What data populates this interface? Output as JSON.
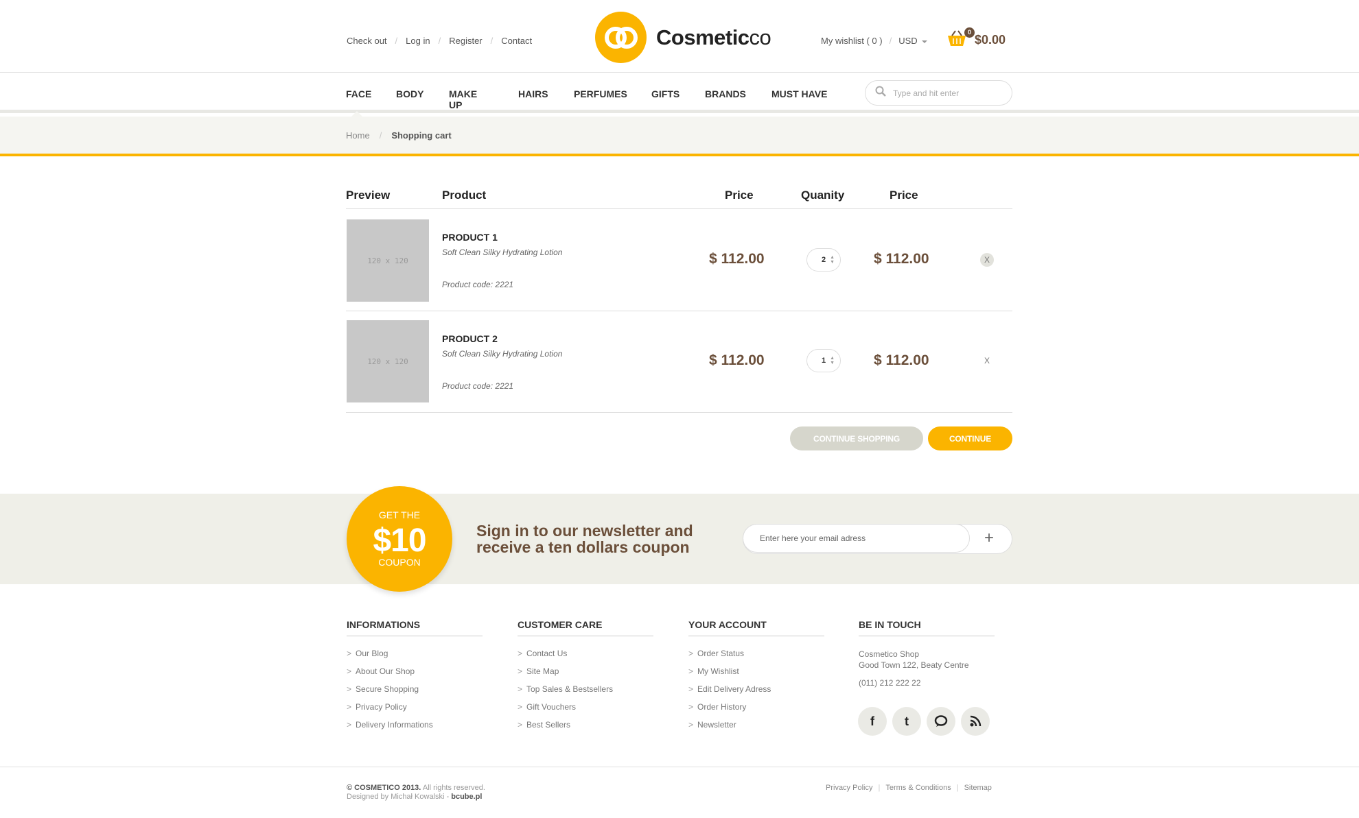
{
  "header": {
    "top_links": [
      "Check out",
      "Log in",
      "Register",
      "Contact"
    ],
    "brand_bold": "Cosmetic",
    "brand_light": "co",
    "wishlist": "My wishlist ( 0 )",
    "currency": "USD",
    "cart_count": "0",
    "cart_total": "$0.00"
  },
  "nav": {
    "items": [
      "FACE",
      "BODY",
      "MAKE UP",
      "HAIRS",
      "PERFUMES",
      "GIFTS",
      "BRANDS",
      "MUST HAVE"
    ],
    "search_placeholder": "Type and hit enter"
  },
  "breadcrumb": {
    "home": "Home",
    "current": "Shopping cart"
  },
  "cart": {
    "headers": {
      "preview": "Preview",
      "product": "Product",
      "price": "Price",
      "quantity": "Quanity",
      "total": "Price"
    },
    "items": [
      {
        "thumb": "120 x 120",
        "name": "PRODUCT 1",
        "desc": "Soft Clean Silky Hydrating Lotion",
        "code_label": "Product code:",
        "code": "2221",
        "price": "$ 112.00",
        "qty": "2",
        "total": "$ 112.00",
        "remove": "X"
      },
      {
        "thumb": "120 x 120",
        "name": "PRODUCT 2",
        "desc": "Soft Clean Silky Hydrating Lotion",
        "code_label": "Product code:",
        "code": "2221",
        "price": "$ 112.00",
        "qty": "1",
        "total": "$ 112.00",
        "remove": "X"
      }
    ],
    "continue_shopping": "CONTINUE SHOPPING",
    "continue": "CONTINUE"
  },
  "newsletter": {
    "coupon_top": "GET THE",
    "coupon_amount": "$10",
    "coupon_bottom": "COUPON",
    "line1": "Sign in to our newsletter and",
    "line2": "receive a ten dollars coupon",
    "placeholder": "Enter here your email adress",
    "submit": "+"
  },
  "footer": {
    "informations": {
      "title": "INFORMATIONS",
      "links": [
        "Our Blog",
        "About Our Shop",
        "Secure Shopping",
        "Privacy Policy",
        "Delivery Informations"
      ]
    },
    "customer_care": {
      "title": "CUSTOMER CARE",
      "links": [
        "Contact Us",
        "Site Map",
        "Top Sales & Bestsellers",
        "Gift Vouchers",
        "Best Sellers"
      ]
    },
    "your_account": {
      "title": "YOUR ACCOUNT",
      "links": [
        "Order Status",
        "My Wishlist",
        "Edit Delivery Adress",
        "Order History",
        "Newsletter"
      ]
    },
    "be_in_touch": {
      "title": "BE IN TOUCH",
      "name": "Cosmetico Shop",
      "address": "Good Town 122, Beaty Centre",
      "phone": "(011) 212 222 22"
    },
    "social": [
      "facebook-icon",
      "twitter-icon",
      "chat-icon",
      "rss-icon"
    ],
    "copyright_bold": "© COSMETICO 2013.",
    "copyright_rest": "All rights reserved.",
    "designed_by": "Designed by Michał Kowalski -",
    "designer_site": "bcube.pl",
    "bottom_links": [
      "Privacy Policy",
      "Terms & Conditions",
      "Sitemap"
    ]
  },
  "colors": {
    "accent": "#fbb400",
    "brown": "#6b4f3a",
    "band": "#efefe8"
  }
}
